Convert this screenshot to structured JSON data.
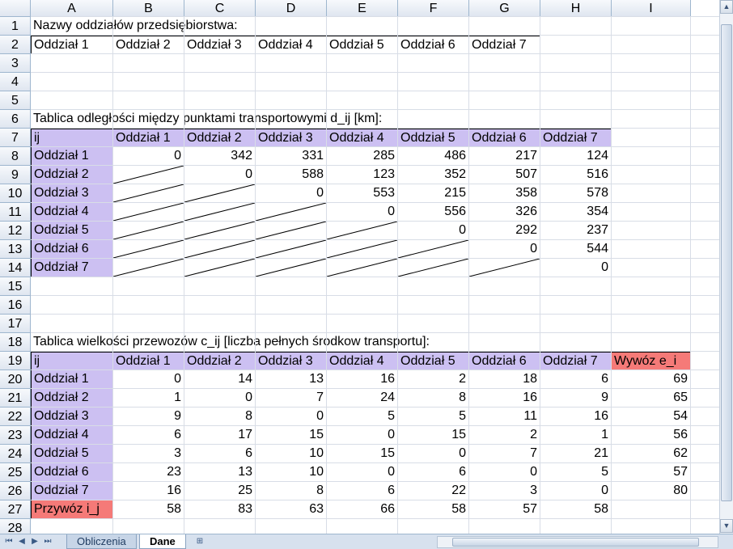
{
  "columns": [
    "A",
    "B",
    "C",
    "D",
    "E",
    "F",
    "G",
    "H",
    "I"
  ],
  "rows": [
    "1",
    "2",
    "3",
    "4",
    "5",
    "6",
    "7",
    "8",
    "9",
    "10",
    "11",
    "12",
    "13",
    "14",
    "15",
    "16",
    "17",
    "18",
    "19",
    "20",
    "21",
    "22",
    "23",
    "24",
    "25",
    "26",
    "27",
    "28"
  ],
  "section1": {
    "title": "Nazwy oddziałów przedsiębiorstwa:",
    "names": [
      "Oddział 1",
      "Oddział 2",
      "Oddział 3",
      "Oddział 4",
      "Oddział 5",
      "Oddział 6",
      "Oddział 7"
    ]
  },
  "distance_table": {
    "title": "Tablica odległości między punktami transportowymi d_ij [km]:",
    "corner": "ij",
    "headers": [
      "Oddział 1",
      "Oddział 2",
      "Oddział 3",
      "Oddział 4",
      "Oddział 5",
      "Oddział 6",
      "Oddział 7"
    ],
    "rows": [
      {
        "label": "Oddział 1",
        "values": [
          "0",
          "342",
          "331",
          "285",
          "486",
          "217",
          "124"
        ]
      },
      {
        "label": "Oddział 2",
        "values": [
          "",
          "0",
          "588",
          "123",
          "352",
          "507",
          "516"
        ]
      },
      {
        "label": "Oddział 3",
        "values": [
          "",
          "",
          "0",
          "553",
          "215",
          "358",
          "578"
        ]
      },
      {
        "label": "Oddział 4",
        "values": [
          "",
          "",
          "",
          "0",
          "556",
          "326",
          "354"
        ]
      },
      {
        "label": "Oddział 5",
        "values": [
          "",
          "",
          "",
          "",
          "0",
          "292",
          "237"
        ]
      },
      {
        "label": "Oddział 6",
        "values": [
          "",
          "",
          "",
          "",
          "",
          "0",
          "544"
        ]
      },
      {
        "label": "Oddział 7",
        "values": [
          "",
          "",
          "",
          "",
          "",
          "",
          "0"
        ]
      }
    ]
  },
  "transport_table": {
    "title": "Tablica wielkości przewozów c_ij [liczba pełnych środkow transportu]:",
    "corner": "ij",
    "headers": [
      "Oddział 1",
      "Oddział 2",
      "Oddział 3",
      "Oddział 4",
      "Oddział 5",
      "Oddział 6",
      "Oddział 7"
    ],
    "export_header": "Wywóz e_i",
    "rows": [
      {
        "label": "Oddział 1",
        "values": [
          "0",
          "14",
          "13",
          "16",
          "2",
          "18",
          "6"
        ],
        "export": "69"
      },
      {
        "label": "Oddział 2",
        "values": [
          "1",
          "0",
          "7",
          "24",
          "8",
          "16",
          "9"
        ],
        "export": "65"
      },
      {
        "label": "Oddział 3",
        "values": [
          "9",
          "8",
          "0",
          "5",
          "5",
          "11",
          "16"
        ],
        "export": "54"
      },
      {
        "label": "Oddział 4",
        "values": [
          "6",
          "17",
          "15",
          "0",
          "15",
          "2",
          "1"
        ],
        "export": "56"
      },
      {
        "label": "Oddział 5",
        "values": [
          "3",
          "6",
          "10",
          "15",
          "0",
          "7",
          "21"
        ],
        "export": "62"
      },
      {
        "label": "Oddział 6",
        "values": [
          "23",
          "13",
          "10",
          "0",
          "6",
          "0",
          "5"
        ],
        "export": "57"
      },
      {
        "label": "Oddział 7",
        "values": [
          "16",
          "25",
          "8",
          "6",
          "22",
          "3",
          "0"
        ],
        "export": "80"
      }
    ],
    "import_label": "Przywóz i_j",
    "import_values": [
      "58",
      "83",
      "63",
      "66",
      "58",
      "57",
      "58"
    ]
  },
  "tabs": {
    "sheet1": "Obliczenia",
    "sheet2": "Dane",
    "active": "Dane"
  },
  "colors": {
    "header_fill": "#ccc0f2",
    "highlight_fill": "#f57a78"
  }
}
